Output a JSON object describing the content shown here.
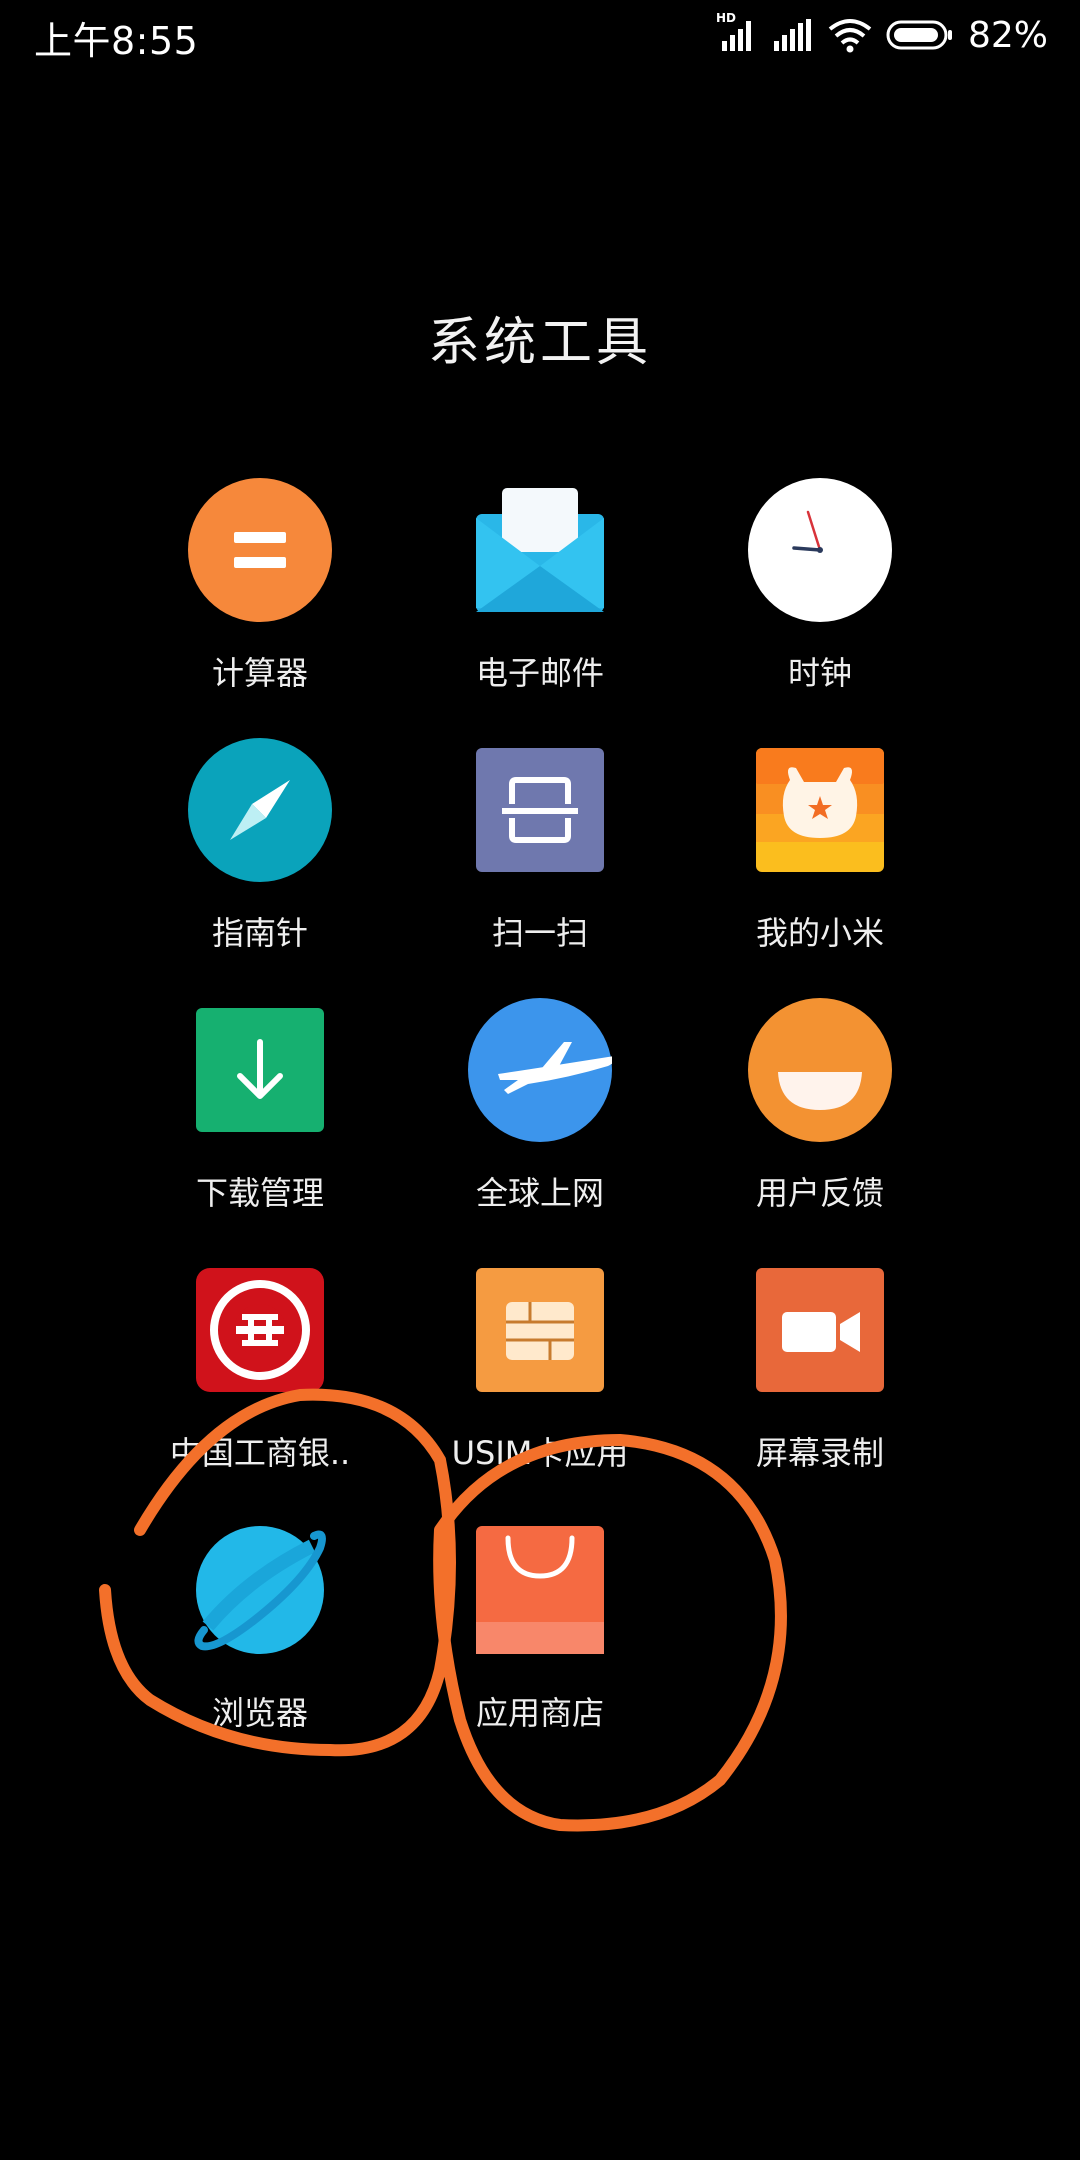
{
  "status_bar": {
    "time": "上午8:55",
    "network_badge": "HD",
    "battery_percent": "82%",
    "icons": [
      "hd-signal-icon",
      "signal-icon",
      "wifi-icon",
      "battery-icon"
    ]
  },
  "folder": {
    "title": "系统工具"
  },
  "apps": [
    {
      "label": "计算器",
      "icon": "calculator-icon",
      "color": "#F6883B"
    },
    {
      "label": "电子邮件",
      "icon": "email-icon",
      "color": "#2AB7E8"
    },
    {
      "label": "时钟",
      "icon": "clock-icon",
      "color": "#FFFFFF"
    },
    {
      "label": "指南针",
      "icon": "compass-icon",
      "color": "#0AA3BB"
    },
    {
      "label": "扫一扫",
      "icon": "scan-icon",
      "color": "#6F78AE"
    },
    {
      "label": "我的小米",
      "icon": "mi-bunny-icon",
      "color": "#F98A1D"
    },
    {
      "label": "下载管理",
      "icon": "download-icon",
      "color": "#16B070"
    },
    {
      "label": "全球上网",
      "icon": "airplane-icon",
      "color": "#3C95EC"
    },
    {
      "label": "用户反馈",
      "icon": "smile-icon",
      "color": "#F39232"
    },
    {
      "label": "中国工商银..",
      "icon": "icbc-icon",
      "color": "#D0121B"
    },
    {
      "label": "USIM卡应用",
      "icon": "sim-card-icon",
      "color": "#F59B41"
    },
    {
      "label": "屏幕录制",
      "icon": "video-camera-icon",
      "color": "#E8683A"
    },
    {
      "label": "浏览器",
      "icon": "browser-planet-icon",
      "color": "#22B8E8"
    },
    {
      "label": "应用商店",
      "icon": "shopping-bag-icon",
      "color": "#F56A42"
    }
  ],
  "annotation": {
    "stroke_color": "#F3702A"
  }
}
